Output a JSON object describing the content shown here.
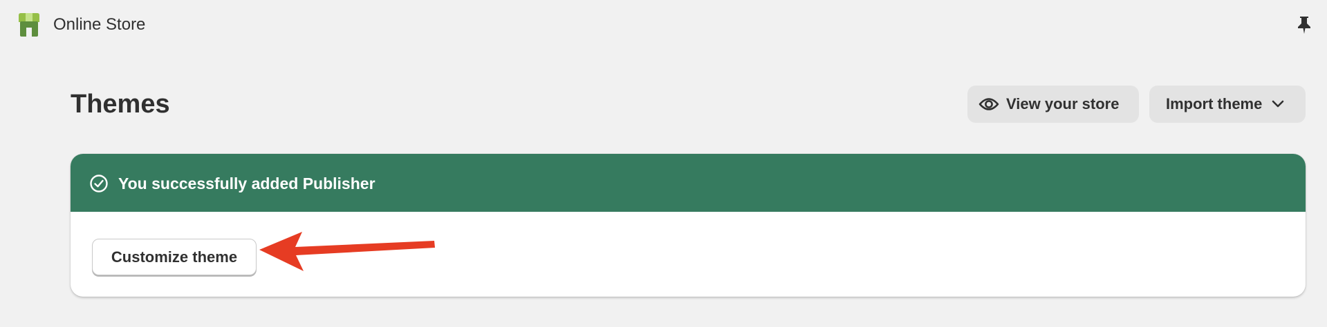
{
  "topbar": {
    "app_title": "Online Store",
    "logo_icon": "online-store-icon",
    "pin_icon": "pin-icon"
  },
  "header": {
    "page_title": "Themes",
    "view_store_label": "View your store",
    "import_theme_label": "Import theme"
  },
  "banner": {
    "message": "You successfully added Publisher",
    "action_label": "Customize theme",
    "header_color": "#367b5f"
  },
  "annotation": {
    "arrow_color": "#e63c23",
    "points_to": "customize-theme-button"
  }
}
